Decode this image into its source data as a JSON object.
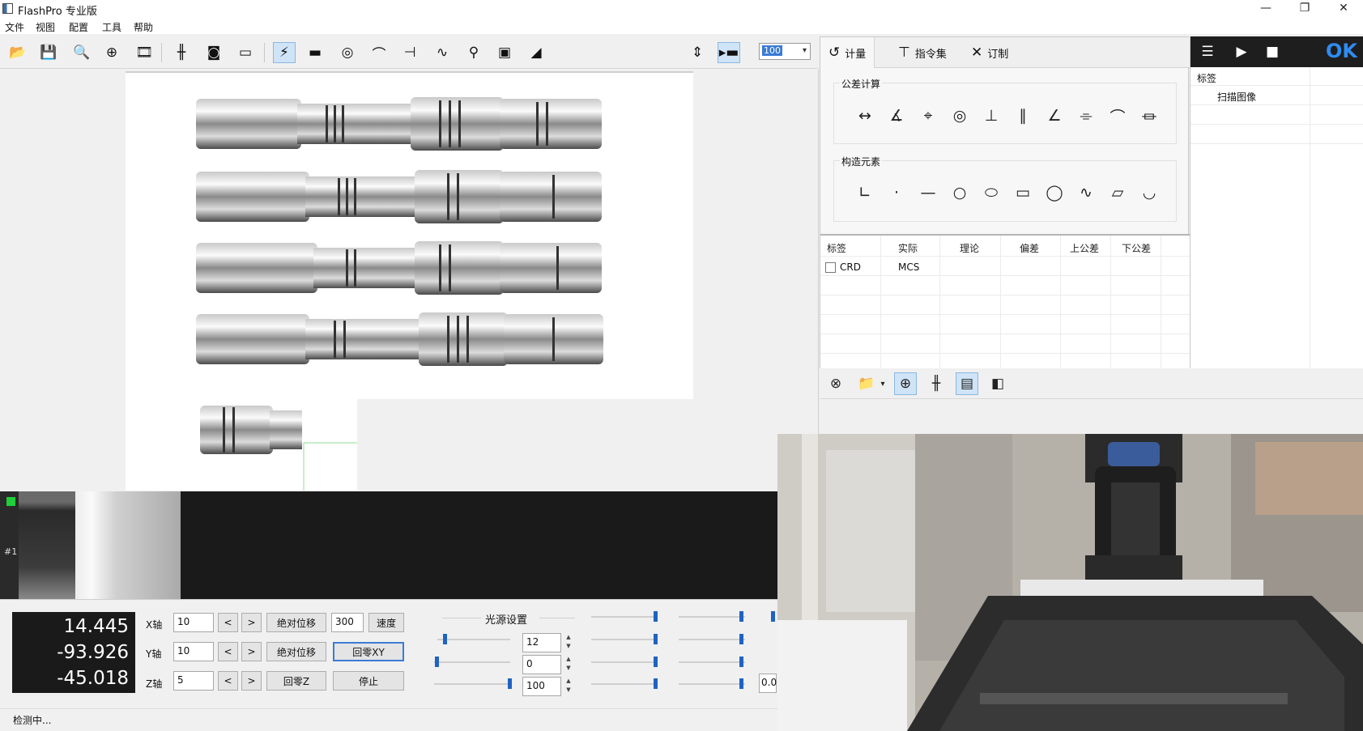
{
  "window": {
    "title": "FlashPro 专业版",
    "minimize": "—",
    "restore": "❐",
    "close": "✕"
  },
  "menu": [
    "文件",
    "视图",
    "配置",
    "工具",
    "帮助"
  ],
  "toolbar": {
    "zoom_value": "100",
    "zoom_arrow": "▾"
  },
  "tabs": [
    {
      "label": "计量",
      "icon": "measure-icon"
    },
    {
      "label": "指令集",
      "icon": "tree-icon"
    },
    {
      "label": "订制",
      "icon": "tools-icon"
    }
  ],
  "groups": {
    "tolerance_title": "公差计算",
    "construct_title": "构造元素"
  },
  "results": {
    "headers": [
      "标签",
      "实际",
      "理论",
      "偏差",
      "上公差",
      "下公差"
    ],
    "rows": [
      {
        "label": "CRD",
        "actual": "MCS"
      }
    ]
  },
  "far_right": {
    "ok": "OK",
    "col_label": "标签",
    "item": "扫描图像"
  },
  "camera": {
    "label": "#1"
  },
  "readout": {
    "x": "14.445",
    "y": "-93.926",
    "z": "-45.018"
  },
  "axes": {
    "x": {
      "label": "X轴",
      "step": "10"
    },
    "y": {
      "label": "Y轴",
      "step": "10"
    },
    "z": {
      "label": "Z轴",
      "step": "5"
    }
  },
  "buttons": {
    "prev": "<",
    "next": ">",
    "abs_move": "绝对位移",
    "speed": "速度",
    "speed_value": "300",
    "home_xy": "回零XY",
    "home_z": "回零Z",
    "stop": "停止"
  },
  "light": {
    "title": "光源设置",
    "v1": "12",
    "v2": "0",
    "v3": "100",
    "extra": "0.0"
  },
  "status": "检测中...",
  "colors": {
    "accent": "#2f8cf0",
    "dark_panel": "#1a1a1a",
    "indicator": "#1fcf3a",
    "slider": "#1f63c2"
  }
}
